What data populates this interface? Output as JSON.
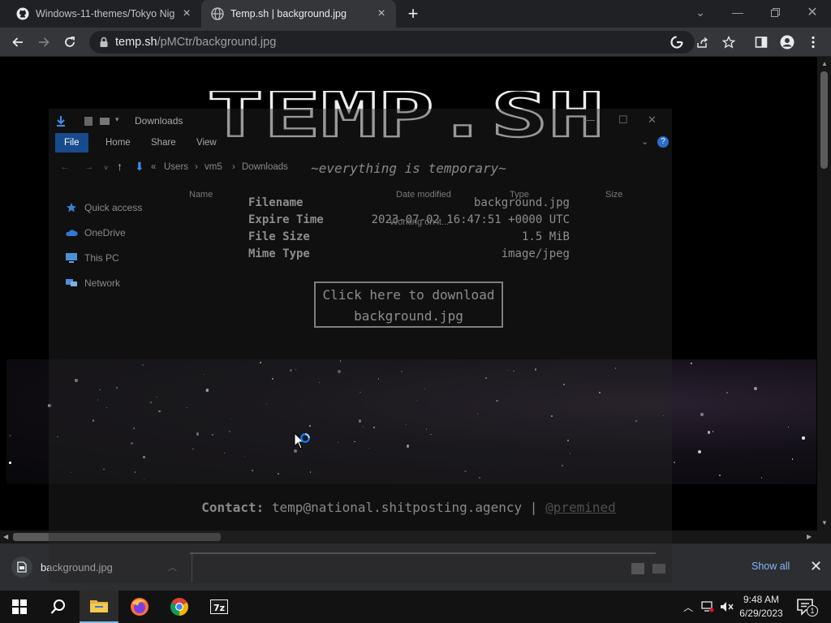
{
  "tabs": [
    {
      "title": "Windows-11-themes/Tokyo Nigh",
      "favicon": "github-icon",
      "active": false
    },
    {
      "title": "Temp.sh | background.jpg",
      "favicon": "globe-icon",
      "active": true
    }
  ],
  "toolbar": {
    "url_host": "temp.sh",
    "url_path": "/pMCtr/background.jpg"
  },
  "page": {
    "logo_text": "TEMP.SH",
    "tagline": "~everything is temporary~",
    "info": {
      "filename_label": "Filename",
      "filename": "background.jpg",
      "expire_label": "Expire Time",
      "expire": "2023-07-02 16:47:51 +0000 UTC",
      "size_label": "File Size",
      "size": "1.5 MiB",
      "mime_label": "Mime Type",
      "mime": "image/jpeg"
    },
    "download_line1": "Click here to download",
    "download_line2": "background.jpg",
    "contact_label": "Contact:",
    "contact_email": "temp@national.shitposting.agency",
    "contact_sep": "|",
    "contact_handle": "@premined"
  },
  "explorer": {
    "title": "Downloads",
    "ribbon_tabs": [
      "File",
      "Home",
      "Share",
      "View"
    ],
    "breadcrumb": [
      "Users",
      "vm5",
      "Downloads"
    ],
    "columns": {
      "name": "Name",
      "date": "Date modified",
      "type": "Type",
      "size": "Size"
    },
    "status": "Working on it...",
    "nav": [
      "Quick access",
      "OneDrive",
      "This PC",
      "Network"
    ]
  },
  "downloads": {
    "file": "background.jpg",
    "show_all": "Show all"
  },
  "taskbar": {
    "time": "9:48 AM",
    "date": "6/29/2023",
    "notifications": "1"
  },
  "colors": {
    "chrome_dark": "#202124",
    "toolbar": "#35363a",
    "link": "#8ab4f8",
    "explorer_accent": "#1a5fb4",
    "taskbar": "#121212"
  }
}
